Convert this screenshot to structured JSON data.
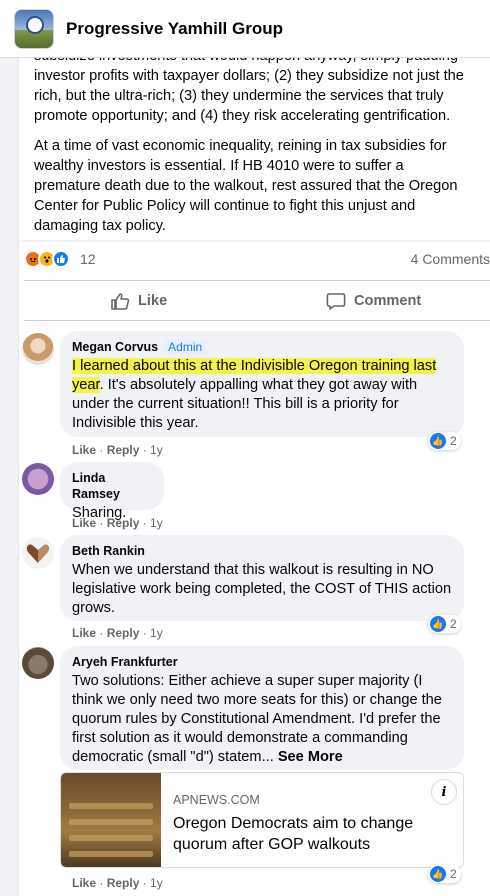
{
  "header": {
    "title": "Progressive Yamhill Group"
  },
  "post": {
    "paragraph_1": "subsidize investments that would happen anyway, simply padding investor profits with taxpayer dollars; (2) they subsidize not just the rich, but the ultra-rich; (3) they undermine the services that truly promote opportunity; and (4) they risk accelerating gentrification.",
    "paragraph_2": "At a time of vast economic inequality, reining in tax subsidies for wealthy investors is essential. If HB 4010 were to suffer a premature death due to the walkout, rest assured that the Oregon Center for Public Policy will continue to fight this unjust and damaging tax policy."
  },
  "reactions": {
    "count": "12",
    "comments": "4 Comments"
  },
  "actions": {
    "like": "Like",
    "comment": "Comment"
  },
  "comments": [
    {
      "author": "Megan Corvus",
      "badge": "Admin",
      "text_highlighted": "I learned about this at the Indivisible Oregon training last year",
      "text_rest": ". It's absolutely appalling what they got away with under the current situation!! This bill is a priority for Indivisible this year.",
      "like": "Like",
      "reply": "Reply",
      "time": "1y",
      "likes": "2"
    },
    {
      "author": "Linda Ramsey",
      "text": "Sharing.",
      "like": "Like",
      "reply": "Reply",
      "time": "1y"
    },
    {
      "author": "Beth Rankin",
      "text": "When we understand that this walkout is resulting in NO legislative work being completed, the COST of THIS action grows.",
      "like": "Like",
      "reply": "Reply",
      "time": "1y",
      "likes": "2"
    },
    {
      "author": "Aryeh Frankfurter",
      "text": "Two solutions: Either achieve a super super majority (I think we only need two more seats for this) or change the quorum rules by Constitutional Amendment. I'd prefer the first solution as it would demonstrate a commanding democratic (small \"d\") statem...",
      "see_more": "See More",
      "like": "Like",
      "reply": "Reply",
      "time": "1y",
      "likes": "2",
      "link": {
        "domain": "APNEWS.COM",
        "title": "Oregon Democrats aim to change quorum after GOP walkouts"
      }
    }
  ],
  "colors": {
    "accent": "#1877f2",
    "highlight": "#f3f34a",
    "bubble": "#f0f2f5"
  }
}
